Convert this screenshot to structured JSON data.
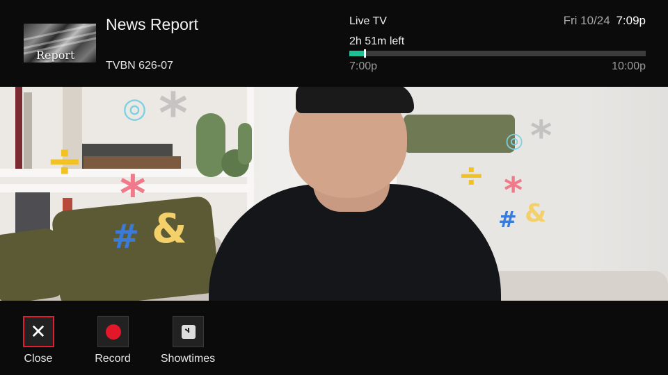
{
  "program": {
    "title": "News Report",
    "thumbnail_text": "Report",
    "channel": "TVBN 626-07"
  },
  "playback": {
    "status_label": "Live TV",
    "time_left": "2h 51m left",
    "start_time": "7:00p",
    "end_time": "10:00p",
    "progress_fraction": 0.05
  },
  "clock": {
    "date": "Fri 10/24",
    "time": "7:09p"
  },
  "actions": [
    {
      "label": "Close",
      "icon": "close-icon",
      "selected": true
    },
    {
      "label": "Record",
      "icon": "record-icon",
      "selected": false
    },
    {
      "label": "Showtimes",
      "icon": "clock-icon",
      "selected": false
    }
  ],
  "colors": {
    "progress": "#1fbf95",
    "record": "#e3172a",
    "selection_border": "#e0202e",
    "bar_background": "#0b0b0b"
  }
}
